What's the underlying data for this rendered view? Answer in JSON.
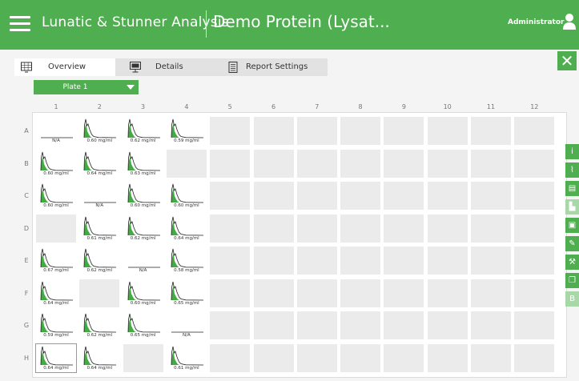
{
  "header": {
    "app_title": "Lunatic & Stunner Analysis",
    "document_title": "Demo Protein (Lysat...",
    "user_name": "Administrator",
    "brand_color": "#4fae4f"
  },
  "tabs": [
    {
      "label": "Overview",
      "icon": "grid-view-icon",
      "active": true
    },
    {
      "label": "Details",
      "icon": "monitor-icon",
      "active": false
    },
    {
      "label": "Report Settings",
      "icon": "report-icon",
      "active": false
    }
  ],
  "plate_select": {
    "value": "Plate 1"
  },
  "plate": {
    "columns": [
      "1",
      "2",
      "3",
      "4",
      "5",
      "6",
      "7",
      "8",
      "9",
      "10",
      "11",
      "12"
    ],
    "rows": [
      "A",
      "B",
      "C",
      "D",
      "E",
      "F",
      "G",
      "H"
    ],
    "wells": [
      {
        "row": "A",
        "col": 1,
        "value": "N/A",
        "spectrum": false
      },
      {
        "row": "A",
        "col": 2,
        "value": "0.60 mg/ml",
        "spectrum": true
      },
      {
        "row": "A",
        "col": 3,
        "value": "0.62 mg/ml",
        "spectrum": true
      },
      {
        "row": "A",
        "col": 4,
        "value": "0.59 mg/ml",
        "spectrum": true
      },
      {
        "row": "B",
        "col": 1,
        "value": "0.60 mg/ml",
        "spectrum": true
      },
      {
        "row": "B",
        "col": 2,
        "value": "0.64 mg/ml",
        "spectrum": true
      },
      {
        "row": "B",
        "col": 3,
        "value": "0.63 mg/ml",
        "spectrum": true
      },
      {
        "row": "C",
        "col": 1,
        "value": "0.60 mg/ml",
        "spectrum": true
      },
      {
        "row": "C",
        "col": 2,
        "value": "N/A",
        "spectrum": false
      },
      {
        "row": "C",
        "col": 3,
        "value": "0.60 mg/ml",
        "spectrum": true
      },
      {
        "row": "C",
        "col": 4,
        "value": "0.60 mg/ml",
        "spectrum": true
      },
      {
        "row": "D",
        "col": 2,
        "value": "0.61 mg/ml",
        "spectrum": true
      },
      {
        "row": "D",
        "col": 3,
        "value": "0.62 mg/ml",
        "spectrum": true
      },
      {
        "row": "D",
        "col": 4,
        "value": "0.64 mg/ml",
        "spectrum": true
      },
      {
        "row": "E",
        "col": 1,
        "value": "0.67 mg/ml",
        "spectrum": true
      },
      {
        "row": "E",
        "col": 2,
        "value": "0.62 mg/ml",
        "spectrum": true
      },
      {
        "row": "E",
        "col": 3,
        "value": "N/A",
        "spectrum": false
      },
      {
        "row": "E",
        "col": 4,
        "value": "0.58 mg/ml",
        "spectrum": true
      },
      {
        "row": "F",
        "col": 1,
        "value": "0.64 mg/ml",
        "spectrum": true
      },
      {
        "row": "F",
        "col": 3,
        "value": "0.60 mg/ml",
        "spectrum": true
      },
      {
        "row": "F",
        "col": 4,
        "value": "0.65 mg/ml",
        "spectrum": true
      },
      {
        "row": "G",
        "col": 1,
        "value": "0.59 mg/ml",
        "spectrum": true
      },
      {
        "row": "G",
        "col": 2,
        "value": "0.62 mg/ml",
        "spectrum": true
      },
      {
        "row": "G",
        "col": 3,
        "value": "0.65 mg/ml",
        "spectrum": true
      },
      {
        "row": "G",
        "col": 4,
        "value": "N/A",
        "spectrum": false
      },
      {
        "row": "H",
        "col": 1,
        "value": "0.64 mg/ml",
        "spectrum": true,
        "selected": true
      },
      {
        "row": "H",
        "col": 2,
        "value": "0.64 mg/ml",
        "spectrum": true
      },
      {
        "row": "H",
        "col": 4,
        "value": "0.61 mg/ml",
        "spectrum": true
      }
    ]
  },
  "side_toolbar": [
    {
      "icon": "info-icon",
      "glyph": "i",
      "enabled": true
    },
    {
      "icon": "chart-icon",
      "glyph": "⌇",
      "enabled": true
    },
    {
      "icon": "table-icon",
      "glyph": "▤",
      "enabled": true
    },
    {
      "icon": "bar-chart-icon",
      "glyph": "▙",
      "enabled": false
    },
    {
      "icon": "monitor-icon",
      "glyph": "▣",
      "enabled": true
    },
    {
      "icon": "pencil-icon",
      "glyph": "✎",
      "enabled": true
    },
    {
      "icon": "wrench-icon",
      "glyph": "⚒",
      "enabled": true
    },
    {
      "icon": "copy-icon",
      "glyph": "❐",
      "enabled": true
    },
    {
      "icon": "b-icon",
      "glyph": "B",
      "enabled": false
    }
  ]
}
